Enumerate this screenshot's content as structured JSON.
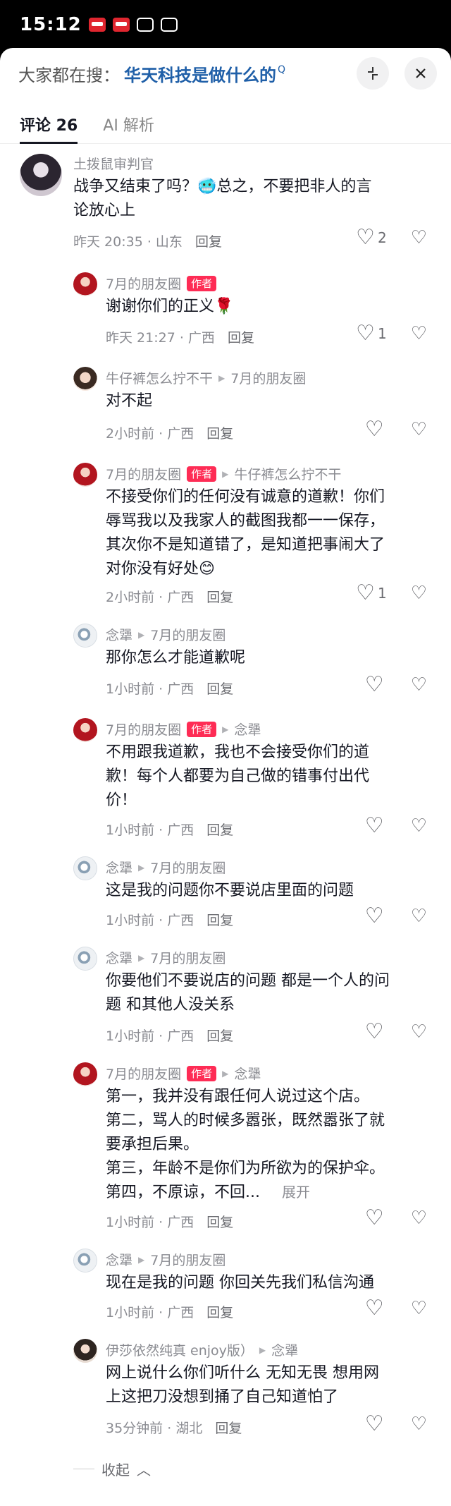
{
  "status": {
    "time": "15:12"
  },
  "search": {
    "label": "大家都在搜：",
    "query": "华天科技是做什么的",
    "q_mark": "Q"
  },
  "tabs": [
    {
      "label": "评论 26"
    },
    {
      "label": "AI 解析"
    }
  ],
  "comments": [
    {
      "name": "土拨鼠审判官",
      "text": "战争又结束了吗？🥶总之，不要把非人的言\n论放心上",
      "time": "昨天 20:35",
      "loc": "山东",
      "reply": "回复",
      "likes": "2"
    },
    {
      "name": "7月的朋友圈",
      "badge": "作者",
      "text": "谢谢你们的正义🌹",
      "time": "昨天 21:27",
      "loc": "广西",
      "reply": "回复",
      "likes": "1"
    },
    {
      "name": "牛仔裤怎么拧不干",
      "to": "7月的朋友圈",
      "text": "对不起",
      "time": "2小时前",
      "loc": "广西",
      "reply": "回复",
      "likes": ""
    },
    {
      "name": "7月的朋友圈",
      "badge": "作者",
      "to": "牛仔裤怎么拧不干",
      "text": "不接受你们的任何没有诚意的道歉！你们\n辱骂我以及我家人的截图我都一一保存，\n其次你不是知道错了，是知道把事闹大了\n对你没有好处😊",
      "time": "2小时前",
      "loc": "广西",
      "reply": "回复",
      "likes": "1"
    },
    {
      "name": "念犟",
      "to": "7月的朋友圈",
      "text": "那你怎么才能道歉呢",
      "time": "1小时前",
      "loc": "广西",
      "reply": "回复",
      "likes": ""
    },
    {
      "name": "7月的朋友圈",
      "badge": "作者",
      "to": "念犟",
      "text": "不用跟我道歉，我也不会接受你们的道\n歉！每个人都要为自己做的错事付出代\n价！",
      "time": "1小时前",
      "loc": "广西",
      "reply": "回复",
      "likes": ""
    },
    {
      "name": "念犟",
      "to": "7月的朋友圈",
      "text": "这是我的问题你不要说店里面的问题",
      "time": "1小时前",
      "loc": "广西",
      "reply": "回复",
      "likes": ""
    },
    {
      "name": "念犟",
      "to": "7月的朋友圈",
      "text": "你要他们不要说店的问题 都是一个人的问\n题 和其他人没关系",
      "time": "1小时前",
      "loc": "广西",
      "reply": "回复",
      "likes": ""
    },
    {
      "name": "7月的朋友圈",
      "badge": "作者",
      "to": "念犟",
      "text": "第一，我并没有跟任何人说过这个店。\n第二，骂人的时候多嚣张，既然嚣张了就\n要承担后果。\n第三，年龄不是你们为所欲为的保护伞。\n第四，不原谅，不回...",
      "expand": "展开",
      "time": "1小时前",
      "loc": "广西",
      "reply": "回复",
      "likes": ""
    },
    {
      "name": "念犟",
      "to": "7月的朋友圈",
      "text": "现在是我的问题 你回关先我们私信沟通",
      "time": "1小时前",
      "loc": "广西",
      "reply": "回复",
      "likes": ""
    },
    {
      "name": "伊莎依然纯真 enjoy版）",
      "to": "念犟",
      "text": "网上说什么你们听什么 无知无畏 想用网\n上这把刀没想到捅了自己知道怕了",
      "time": "35分钟前",
      "loc": "湖北",
      "reply": "回复",
      "likes": ""
    }
  ],
  "collapse_label": "收起",
  "colors": {
    "accent": "#fe2c55",
    "link": "#1f5fa8"
  }
}
